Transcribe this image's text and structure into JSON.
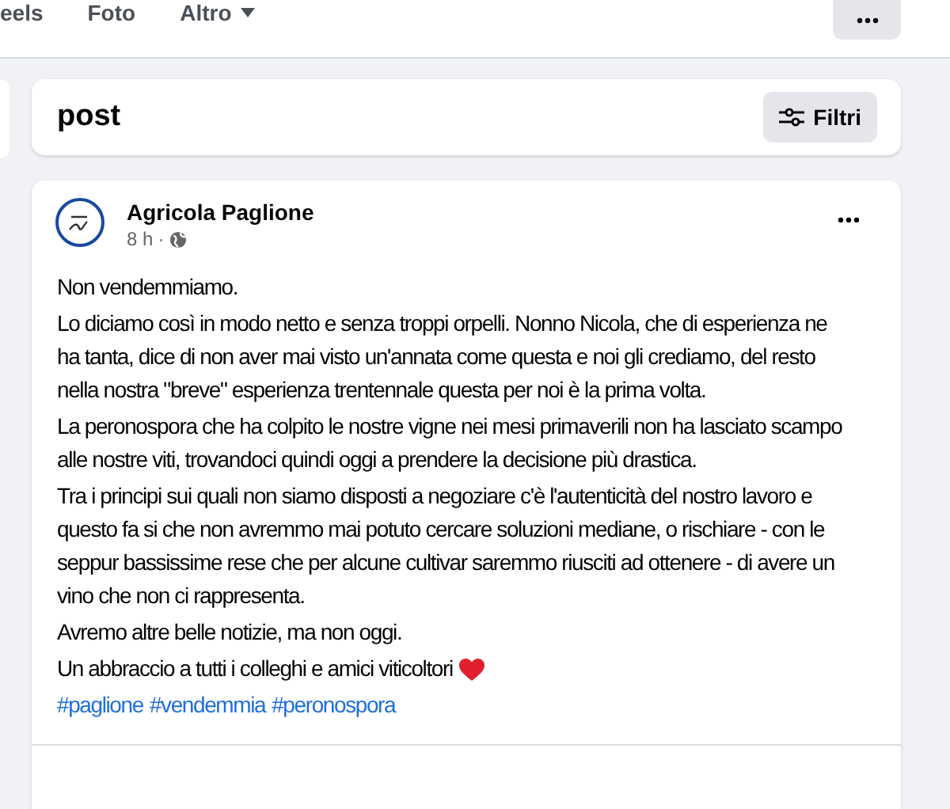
{
  "nav": {
    "tabs": [
      {
        "label": "eels",
        "kind": "link"
      },
      {
        "label": "Foto",
        "kind": "link"
      },
      {
        "label": "Altro",
        "kind": "dropdown"
      }
    ]
  },
  "section": {
    "title": "post",
    "filter_button": "Filtri"
  },
  "post": {
    "author": "Agricola Paglione",
    "time": "8 h",
    "separator": "·",
    "paragraphs": [
      "Non vendemmiamo.",
      "Lo diciamo così in modo netto e senza troppi orpelli. Nonno Nicola, che di esperienza ne ha tanta, dice di non aver mai visto un'annata come questa e noi gli crediamo, del resto nella nostra \"breve\" esperienza trentennale questa per noi è la prima volta.",
      "La peronospora che ha colpito le nostre vigne nei mesi primaverili non ha lasciato scampo alle nostre viti, trovandoci quindi oggi a prendere la decisione più drastica.",
      "Tra i principi sui quali non siamo disposti a negoziare c'è l'autenticità del nostro lavoro e questo fa si che non avremmo mai potuto cercare soluzioni mediane, o rischiare - con le seppur bassissime rese che per alcune cultivar saremmo riusciti ad ottenere - di avere un vino che non ci rappresenta.",
      "Avremo altre belle notizie, ma non oggi.",
      "Un abbraccio a tutti i colleghi e amici viticoltori"
    ],
    "hashtags": [
      "#paglione",
      "#vendemmia",
      "#peronospora"
    ]
  }
}
